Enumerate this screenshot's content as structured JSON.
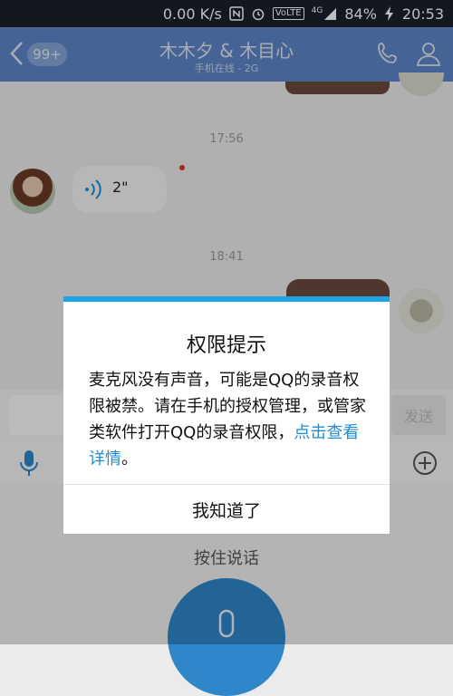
{
  "status_bar": {
    "net_speed": "0.00 K/s",
    "volte": "VoLTE",
    "network": "4G",
    "battery": "84%",
    "time": "20:53"
  },
  "header": {
    "unread_count": "99+",
    "title": "木木夕 & 木目心",
    "subtitle": "手机在线 - 2G"
  },
  "chat": {
    "timestamps": [
      "17:56",
      "18:41"
    ],
    "voice_message_duration": "2\""
  },
  "input": {
    "send_label": "发送"
  },
  "voice_panel": {
    "hold_to_talk": "按住说话"
  },
  "dialog": {
    "title": "权限提示",
    "body_text": "麦克风没有声音，可能是QQ的录音权限被禁。请在手机的授权管理，或管家类软件打开QQ的录音权限，",
    "link_text": "点击查看详情",
    "body_suffix": "。",
    "confirm_label": "我知道了"
  },
  "colors": {
    "title_bar": "#5c86c7",
    "dialog_accent": "#1fa3e3",
    "link": "#1a8ed8",
    "record_button": "#2f86c9"
  }
}
